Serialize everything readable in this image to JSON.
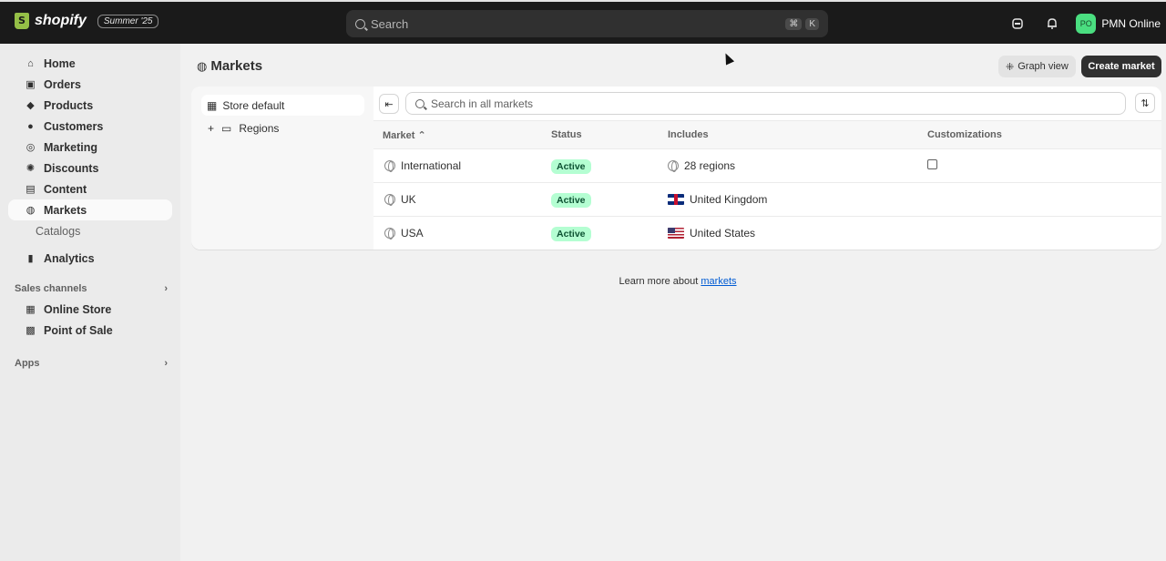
{
  "topbar": {
    "brand": "shopify",
    "edition_badge": "Summer '25",
    "search_placeholder": "Search",
    "shortcut_keys": [
      "⌘",
      "K"
    ],
    "avatar_initials": "PO",
    "store_name": "PMN Online"
  },
  "sidebar": {
    "items": [
      {
        "label": "Home",
        "icon": "home-icon"
      },
      {
        "label": "Orders",
        "icon": "orders-icon"
      },
      {
        "label": "Products",
        "icon": "tag-icon"
      },
      {
        "label": "Customers",
        "icon": "person-icon"
      },
      {
        "label": "Marketing",
        "icon": "target-icon"
      },
      {
        "label": "Discounts",
        "icon": "discount-icon"
      },
      {
        "label": "Content",
        "icon": "content-icon"
      },
      {
        "label": "Markets",
        "icon": "globe-icon"
      }
    ],
    "sub_item": "Catalogs",
    "analytics": "Analytics",
    "sales_channels_label": "Sales channels",
    "channels": [
      "Online Store",
      "Point of Sale"
    ],
    "apps_label": "Apps"
  },
  "page": {
    "title": "Markets",
    "graph_view_label": "Graph view",
    "create_market_label": "Create market"
  },
  "tree": {
    "store_default": "Store default",
    "regions": "Regions"
  },
  "table": {
    "search_placeholder": "Search in all markets",
    "headers": {
      "market": "Market",
      "status": "Status",
      "includes": "Includes",
      "customizations": "Customizations"
    },
    "rows": [
      {
        "market": "International",
        "status": "Active",
        "includes": "28 regions"
      },
      {
        "market": "UK",
        "status": "Active",
        "includes": "United Kingdom"
      },
      {
        "market": "USA",
        "status": "Active",
        "includes": "United States"
      }
    ]
  },
  "footer": {
    "learn_text": "Learn more about",
    "learn_link": "markets"
  },
  "colors": {
    "topbar_bg": "#1a1a1a",
    "status_active_bg": "#b4fed2",
    "primary_button": "#303030",
    "link": "#005bd3"
  }
}
